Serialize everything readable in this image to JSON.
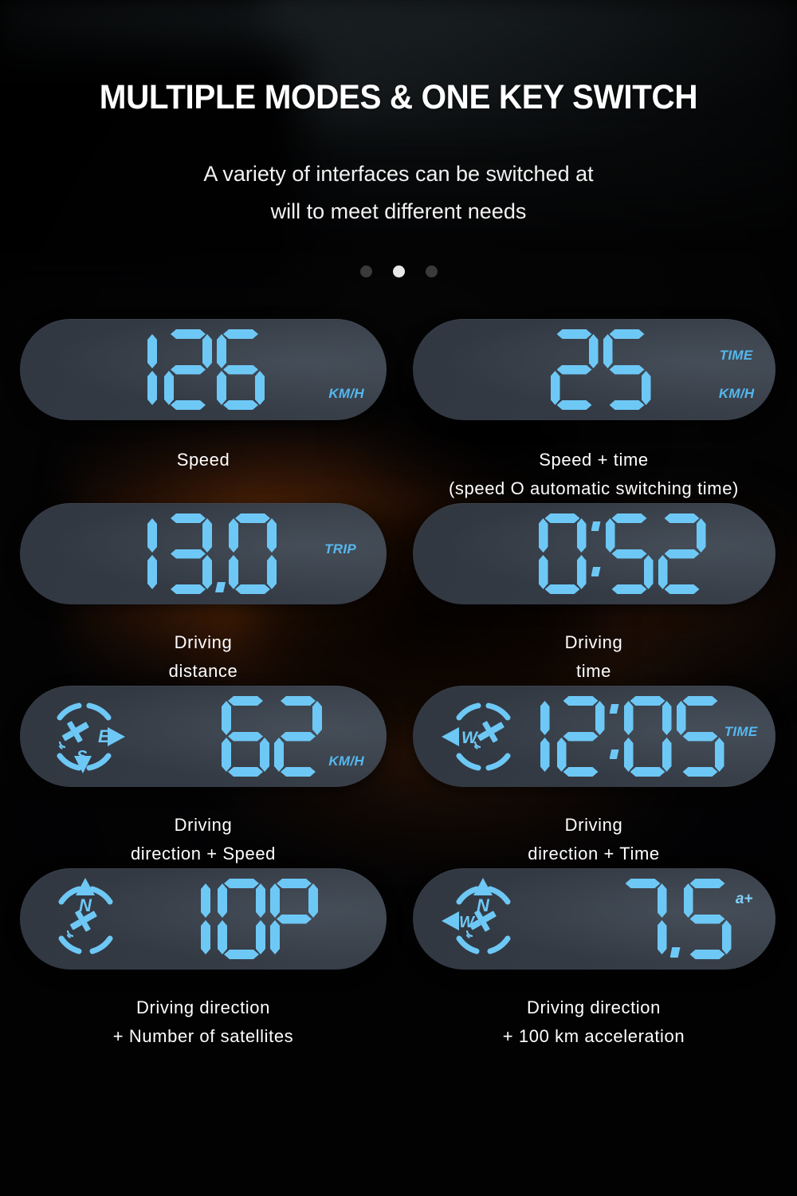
{
  "header": {
    "title": "MULTIPLE MODES & ONE KEY SWITCH",
    "subtitle_line1": "A variety of interfaces can be switched at",
    "subtitle_line2": "will to meet different needs"
  },
  "carousel": {
    "dots": 3,
    "active_index": 1
  },
  "colors": {
    "lcd_blue": "#6ec8f5",
    "unit_blue": "#55b8ee",
    "panel_dark": "#313842",
    "panel_light": "#39404a",
    "text_white": "#ffffff"
  },
  "panels": [
    {
      "id": "speed",
      "value": "126",
      "units": [
        "KM/H"
      ],
      "compass": null,
      "caption_line1": "Speed",
      "caption_line2": ""
    },
    {
      "id": "speed-time",
      "value": "25",
      "units": [
        "TIME",
        "KM/H"
      ],
      "compass": null,
      "caption_line1": "Speed + time",
      "caption_line2": "(speed O automatic switching time)"
    },
    {
      "id": "driving-distance",
      "value": "13.0",
      "units": [
        "TRIP"
      ],
      "compass": null,
      "caption_line1": "Driving",
      "caption_line2": "distance"
    },
    {
      "id": "driving-time",
      "value": "0:52",
      "units": [],
      "compass": null,
      "caption_line1": "Driving",
      "caption_line2": "time"
    },
    {
      "id": "direction-speed",
      "value": "62",
      "units": [
        "KM/H"
      ],
      "compass": {
        "directions": [
          "E",
          "S"
        ]
      },
      "caption_line1": "Driving",
      "caption_line2": "direction + Speed"
    },
    {
      "id": "direction-time",
      "value": "12:05",
      "units": [
        "TIME"
      ],
      "compass": {
        "directions": [
          "W"
        ]
      },
      "caption_line1": "Driving",
      "caption_line2": "direction + Time"
    },
    {
      "id": "direction-satellites",
      "value": "10P",
      "units": [],
      "compass": {
        "directions": [
          "N"
        ]
      },
      "caption_line1": "Driving direction",
      "caption_line2": "+ Number of satellites"
    },
    {
      "id": "direction-acceleration",
      "value": "7.5",
      "units": [],
      "superscript": "a+",
      "compass": {
        "directions": [
          "N",
          "W"
        ]
      },
      "caption_line1": "Driving direction",
      "caption_line2": "+ 100 km acceleration"
    }
  ]
}
